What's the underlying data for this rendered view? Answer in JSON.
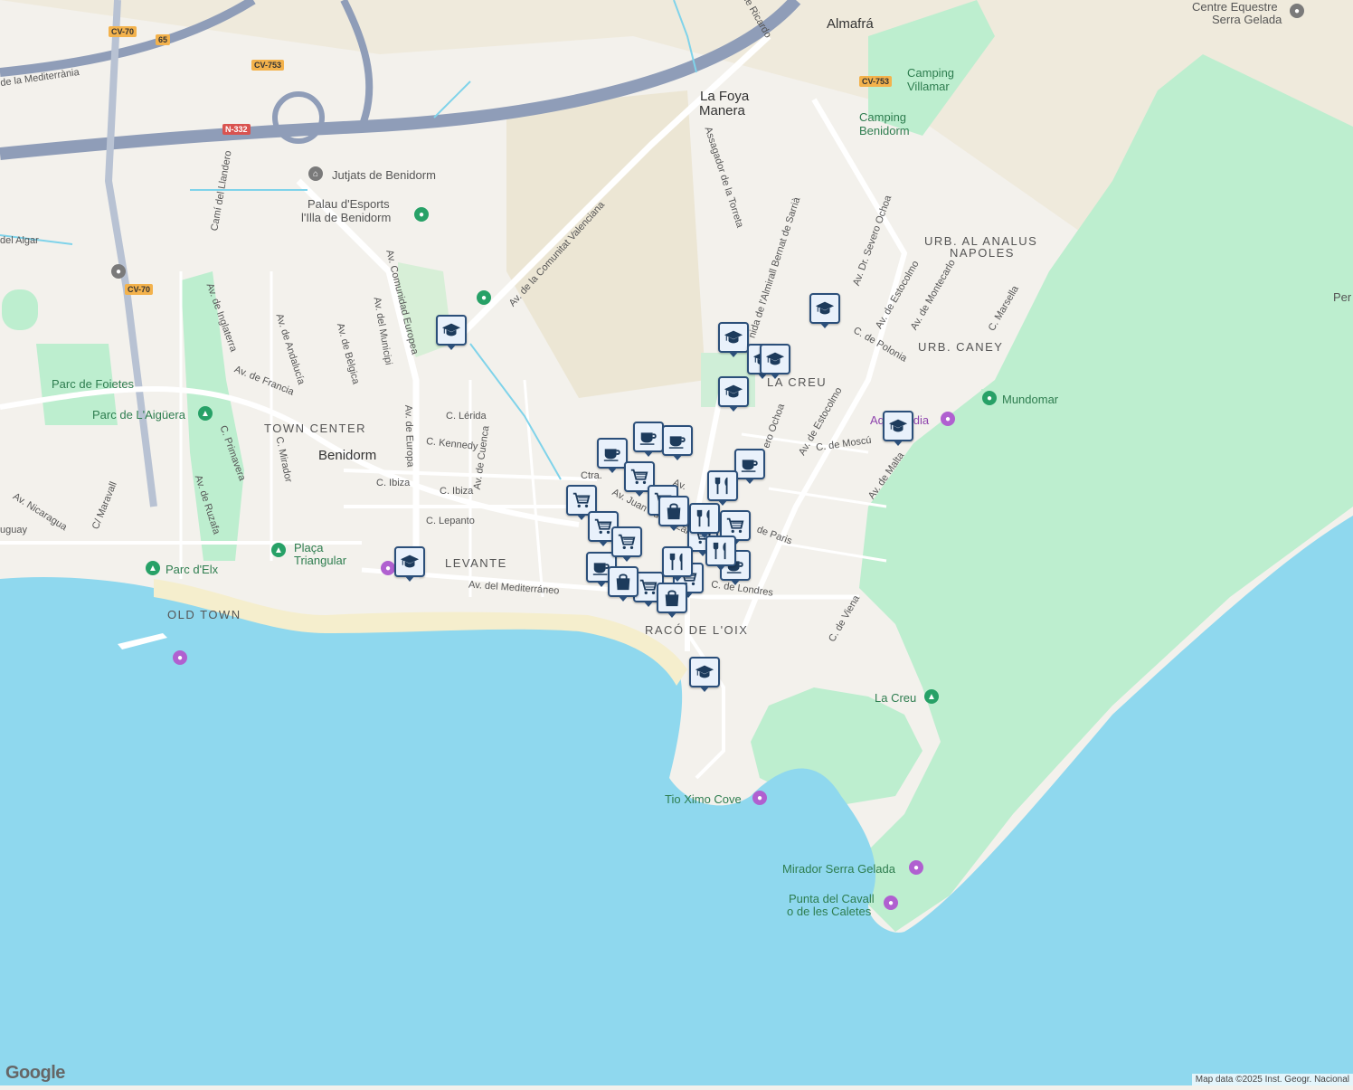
{
  "map": {
    "attribution": "Map data ©2025 Inst. Geogr. Nacional",
    "logo": "Google",
    "colors": {
      "water": "#8fd8ee",
      "land": "#f3f1ec",
      "park": "#bdeecf",
      "beach": "#f5eecd",
      "road": "#ffffff",
      "highway": "#8f9db8",
      "marker": "#2b4f7a"
    }
  },
  "labels": {
    "almafra": "Almafrá",
    "la_foya": "La Foya",
    "manera": "Manera",
    "centre_equestre_1": "Centre Equestre",
    "centre_equestre_2": "Serra Gelada",
    "camping_villamar_1": "Camping",
    "camping_villamar_2": "Villamar",
    "camping_benidorm_1": "Camping",
    "camping_benidorm_2": "Benidorm",
    "jutjats": "Jutjats de Benidorm",
    "palau_1": "Palau d'Esports",
    "palau_2": "l'Illa de Benidorm",
    "urb_al_analus": "URB. AL ANALUS",
    "napoles": "NAPOLES",
    "urb_caney": "URB. CANEY",
    "la_creu_district": "LA CREU",
    "mundomar": "Mundomar",
    "aqualandia": "Aqualandia",
    "town_center": "TOWN CENTER",
    "benidorm": "Benidorm",
    "parc_foietes": "Parc de Foietes",
    "parc_aiguera": "Parc de L'Aigüera",
    "levante": "LEVANTE",
    "placa_1": "Plaça",
    "placa_2": "Triangular",
    "parc_elx": "Parc d'Elx",
    "old_town": "OLD TOWN",
    "raco_oix": "RACÓ DE L'OIX",
    "la_creu_peak": "La Creu",
    "tio_ximo": "Tio Ximo Cove",
    "mirador": "Mirador Serra Gelada",
    "punta_1": "Punta del Cavall",
    "punta_2": "o de les Caletes",
    "per": "Per",
    "mediterrania": "de la Mediterrània",
    "del_algar": "del Algar",
    "uguay": "uguay"
  },
  "streets": {
    "comunitat_valenciana": "Av. de la Comunitat Valenciana",
    "comunidad_europea": "Av. Comunidad Europea",
    "europa": "Av. de Europa",
    "mediterraneo": "Av. del Mediterráneo",
    "severo_ochoa": "Av. Dr. Severo Ochoa",
    "severo_ochoa_short": "erо Ochoa",
    "almirall": "nida de l'Almirall Bernat de Sarrià",
    "assagador": "Assagador de la Torreta",
    "ricardo": "de Ricardo",
    "estocolmo_1": "Av. de Estocolmo",
    "estocolmo_2": "Av. de Estocolmo",
    "montecarlo": "Av. de Montecarlo",
    "marsella": "C. Marsella",
    "polonia": "C. de Polonia",
    "moscu": "C. de Moscú",
    "malta": "Av. de Malta",
    "paris": "de Paris",
    "londres": "C. de Londres",
    "viena": "C. de Viena",
    "lerida": "C. Lérida",
    "kennedy": "C. Kennedy",
    "ibiza_1": "C. Ibiza",
    "ibiza_2": "C. Ibiza",
    "lepanto": "C. Lepanto",
    "cuenca": "Av. de Cuenca",
    "municipi": "Av. del Municipi",
    "belgica": "Av. de Bèlgica",
    "andalucia": "Av. de Andalucía",
    "inglaterra": "Av. de Inglaterra",
    "francia": "Av. de Francia",
    "llandero": "Camí del Llandero",
    "primavera": "C. Primavera",
    "mirador_c": "C. Mirador",
    "ruzafa": "Av. de Ruzafa",
    "maravall": "C/ Maravall",
    "nicaragua": "Av. Nicaragua",
    "juan_fuster": "Av. Juan Fuster Zar",
    "ctra": "Ctra.",
    "av_short": "Av."
  },
  "shields": {
    "cv70_top": "CV-70",
    "r65": "65",
    "cv753_left": "CV-753",
    "n332": "N-332",
    "cv70_mid": "CV-70",
    "cv753_right": "CV-753"
  },
  "markers": [
    {
      "type": "school",
      "icon": "graduation-cap-icon"
    },
    {
      "type": "school",
      "icon": "graduation-cap-icon"
    },
    {
      "type": "school",
      "icon": "graduation-cap-icon"
    },
    {
      "type": "school",
      "icon": "graduation-cap-icon"
    },
    {
      "type": "school",
      "icon": "graduation-cap-icon"
    },
    {
      "type": "school",
      "icon": "graduation-cap-icon"
    },
    {
      "type": "school",
      "icon": "graduation-cap-icon"
    },
    {
      "type": "school",
      "icon": "graduation-cap-icon"
    },
    {
      "type": "school",
      "icon": "graduation-cap-icon"
    },
    {
      "type": "cafe",
      "icon": "coffee-cup-icon"
    },
    {
      "type": "cafe",
      "icon": "coffee-cup-icon"
    },
    {
      "type": "cafe",
      "icon": "coffee-cup-icon"
    },
    {
      "type": "cafe",
      "icon": "coffee-cup-icon"
    },
    {
      "type": "cafe",
      "icon": "coffee-cup-icon"
    },
    {
      "type": "cafe",
      "icon": "coffee-cup-icon"
    },
    {
      "type": "grocery",
      "icon": "shopping-cart-icon"
    },
    {
      "type": "grocery",
      "icon": "shopping-cart-icon"
    },
    {
      "type": "grocery",
      "icon": "shopping-cart-icon"
    },
    {
      "type": "grocery",
      "icon": "shopping-cart-icon"
    },
    {
      "type": "grocery",
      "icon": "shopping-cart-icon"
    },
    {
      "type": "grocery",
      "icon": "shopping-cart-icon"
    },
    {
      "type": "grocery",
      "icon": "shopping-cart-icon"
    },
    {
      "type": "grocery",
      "icon": "shopping-cart-icon"
    },
    {
      "type": "grocery",
      "icon": "shopping-cart-icon"
    },
    {
      "type": "restaurant",
      "icon": "fork-knife-icon"
    },
    {
      "type": "restaurant",
      "icon": "fork-knife-icon"
    },
    {
      "type": "restaurant",
      "icon": "fork-knife-icon"
    },
    {
      "type": "restaurant",
      "icon": "fork-knife-icon"
    },
    {
      "type": "shopping",
      "icon": "shopping-bag-icon"
    },
    {
      "type": "shopping",
      "icon": "shopping-bag-icon"
    },
    {
      "type": "shopping",
      "icon": "shopping-bag-icon"
    }
  ]
}
